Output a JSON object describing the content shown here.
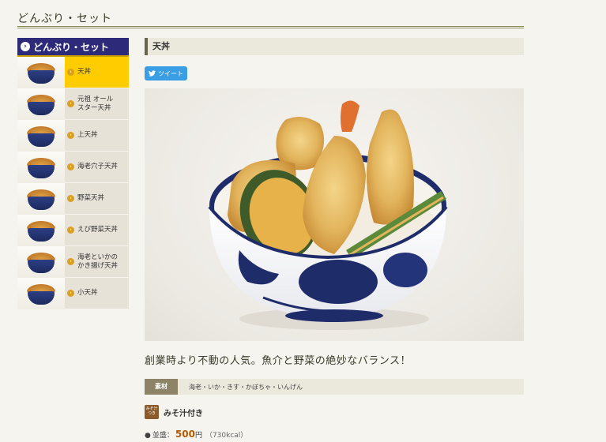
{
  "header": {
    "title": "どんぶり・セット"
  },
  "sidebar": {
    "heading": "どんぶり・セット",
    "items": [
      {
        "label": "天丼",
        "active": true
      },
      {
        "label": "元祖 オール\nスター天丼",
        "active": false
      },
      {
        "label": "上天丼",
        "active": false
      },
      {
        "label": "海老穴子天丼",
        "active": false
      },
      {
        "label": "野菜天丼",
        "active": false
      },
      {
        "label": "えび野菜天丼",
        "active": false
      },
      {
        "label": "海老といかの\nかき揚げ天丼",
        "active": false
      },
      {
        "label": "小天丼",
        "active": false
      }
    ]
  },
  "main": {
    "title": "天丼",
    "tweet_label": "ツイート",
    "catchphrase": "創業時より不動の人気。魚介と野菜の絶妙なバランス！",
    "ingredients": {
      "label": "素材",
      "value": "海老・いか・きす・かぼちゃ・いんげん"
    },
    "miso": {
      "icon_text": "みそ汁つき",
      "label": "みそ汁付き"
    },
    "price": {
      "size": "並盛：",
      "amount": "500",
      "unit": "円",
      "kcal": "（730kcal）"
    }
  },
  "colors": {
    "sidebar_header": "#2e2a7a",
    "active_item": "#ffcc00",
    "price": "#b45a00",
    "tweet": "#3a9ee4"
  },
  "icons": {
    "tweet": "twitter-bird-icon",
    "bullet": "chevron-right-circle-icon"
  }
}
